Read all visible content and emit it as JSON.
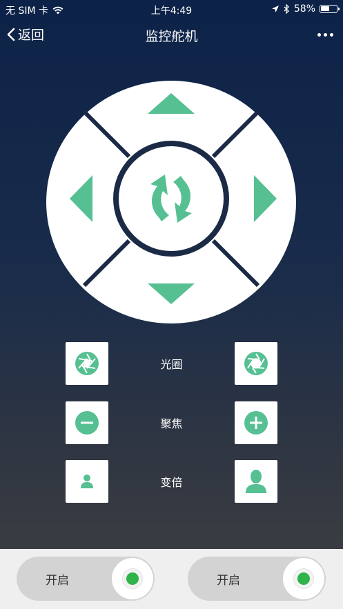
{
  "status_bar": {
    "carrier": "无 SIM 卡",
    "time": "上午4:49",
    "battery_text": "58%",
    "battery_level": 0.58
  },
  "nav": {
    "back_label": "返回",
    "title": "监控舵机"
  },
  "colors": {
    "accent": "#56c092",
    "dpad_divider": "#1b2a45"
  },
  "dpad": {
    "up_icon": "arrow-up-icon",
    "down_icon": "arrow-down-icon",
    "left_icon": "arrow-left-icon",
    "right_icon": "arrow-right-icon",
    "center_icon": "rotate-icon"
  },
  "controls": [
    {
      "label": "光圈",
      "left_icon": "aperture-icon",
      "right_icon": "aperture-icon"
    },
    {
      "label": "聚焦",
      "left_icon": "minus-circle-icon",
      "right_icon": "plus-circle-icon"
    },
    {
      "label": "变倍",
      "left_icon": "person-small-icon",
      "right_icon": "person-large-icon"
    }
  ],
  "toggles": [
    {
      "label": "开启",
      "on": true
    },
    {
      "label": "开启",
      "on": true
    }
  ]
}
